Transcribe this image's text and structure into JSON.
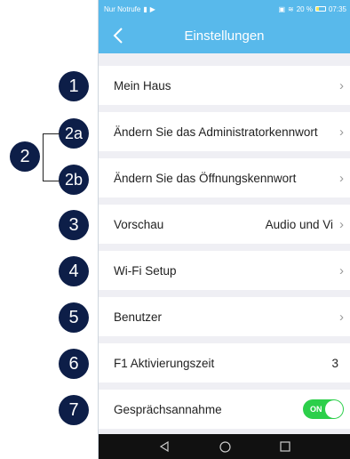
{
  "statusbar": {
    "left_text": "Nur Notrufe",
    "right_text": "20 %",
    "time": "07:35"
  },
  "appbar": {
    "title": "Einstellungen"
  },
  "rows": [
    {
      "label": "Mein Haus",
      "value": "",
      "chevron": "›"
    },
    {
      "label": "Ändern Sie das Administratorkennwort",
      "value": "",
      "chevron": "›"
    },
    {
      "label": "Ändern Sie das Öffnungskennwort",
      "value": "",
      "chevron": "›"
    },
    {
      "label": "Vorschau",
      "value": "Audio und Vi",
      "chevron": "›"
    },
    {
      "label": "Wi-Fi Setup",
      "value": "",
      "chevron": "›"
    },
    {
      "label": "Benutzer",
      "value": "",
      "chevron": "›"
    },
    {
      "label": "F1 Aktivierungszeit",
      "value": "3",
      "chevron": ""
    },
    {
      "label": "Gesprächsannahme",
      "toggle": "ON",
      "toggle_state": true
    }
  ],
  "callouts": [
    "1",
    "2a",
    "2",
    "2b",
    "3",
    "4",
    "5",
    "6",
    "7"
  ],
  "colors": {
    "accent": "#58b9eb",
    "badge": "#0d1e48",
    "toggle_on": "#2ccf4a"
  },
  "icons": {
    "back": "chevron-left-icon",
    "nav": [
      "back-triangle-icon",
      "home-circle-icon",
      "recents-square-icon"
    ]
  }
}
